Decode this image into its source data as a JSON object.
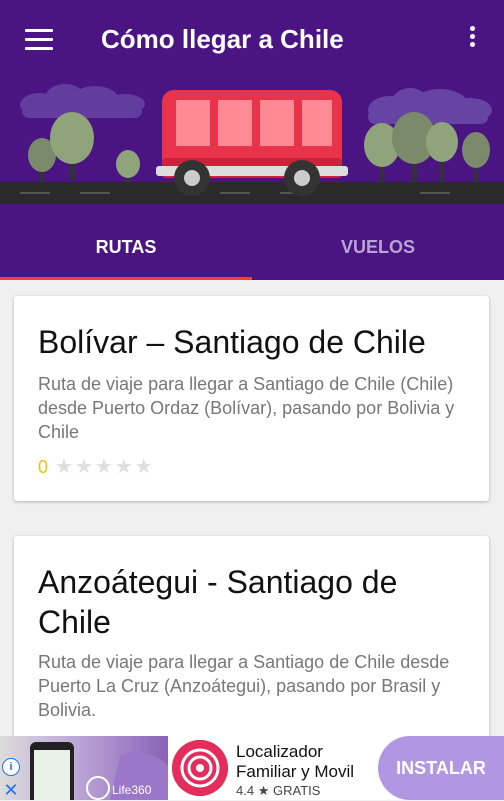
{
  "app": {
    "title": "Cómo llegar a Chile"
  },
  "tabs": [
    {
      "label": "RUTAS",
      "selected": true
    },
    {
      "label": "VUELOS",
      "selected": false
    }
  ],
  "routes": [
    {
      "title": "Bolívar – Santiago de Chile",
      "description": "Ruta de viaje para llegar a Santiago de Chile (Chile) desde Puerto Ordaz (Bolívar), pasando por Bolivia y Chile",
      "rating_count": "0",
      "stars": [
        "★",
        "★",
        "★",
        "★",
        "★"
      ]
    },
    {
      "title": "Anzoátegui - Santiago de Chile",
      "description": "Ruta de viaje para llegar a Santiago de Chile desde Puerto La Cruz (Anzoátegui), pasando por Brasil y Bolivia."
    }
  ],
  "ad": {
    "image_brand": "Life360",
    "app_name": "Localizador Familiar y Movil",
    "rating": "4.4",
    "price": "GRATIS",
    "install_label": "INSTALAR"
  },
  "colors": {
    "appbar": "#4a1483",
    "tab_indicator": "#ff3d2e",
    "rating_accent": "#f2c200",
    "install_button": "#b197e3"
  }
}
